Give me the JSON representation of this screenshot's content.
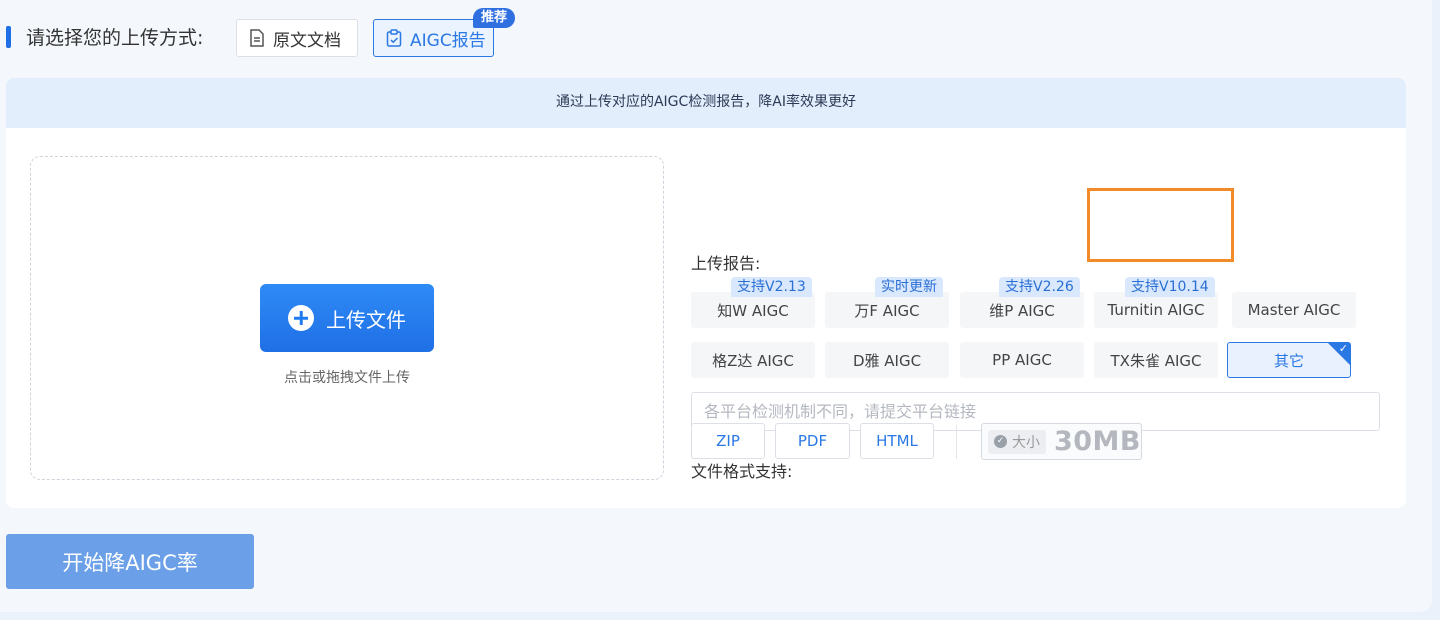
{
  "mode": {
    "title": "请选择您的上传方式:",
    "options": [
      {
        "label": "原文文档",
        "icon": "document-icon"
      },
      {
        "label": "AIGC报告",
        "icon": "report-icon",
        "selected": true
      }
    ],
    "recommend_badge": "推荐"
  },
  "card": {
    "hint": "通过上传对应的AIGC检测报告，降AI率效果更好",
    "upload_button": "上传文件",
    "upload_hint": "点击或拖拽文件上传",
    "report_label": "上传报告:",
    "platforms": [
      {
        "label": "知W AIGC",
        "badge": "支持V2.13"
      },
      {
        "label": "万F AIGC",
        "badge": "实时更新"
      },
      {
        "label": "维P AIGC",
        "badge": "支持V2.26"
      },
      {
        "label": "Turnitin AIGC",
        "badge": "支持V10.14"
      },
      {
        "label": "Master AIGC",
        "badge": ""
      },
      {
        "label": "格Z达 AIGC",
        "badge": ""
      },
      {
        "label": "D雅 AIGC",
        "badge": ""
      },
      {
        "label": "PP AIGC",
        "badge": ""
      },
      {
        "label": "TX朱雀 AIGC",
        "badge": ""
      },
      {
        "label": "其它",
        "badge": "",
        "selected": true
      }
    ],
    "link_placeholder": "各平台检测机制不同，请提交平台链接",
    "link_value": "",
    "format_label": "文件格式支持:",
    "formats": [
      "ZIP",
      "PDF",
      "HTML"
    ],
    "size_label": "大小",
    "size_value": "30MB"
  },
  "start_button": "开始降AIGC率",
  "colors": {
    "accent": "#2a78e4",
    "highlight": "#f28a27",
    "start_button": "#6ba0e8"
  }
}
